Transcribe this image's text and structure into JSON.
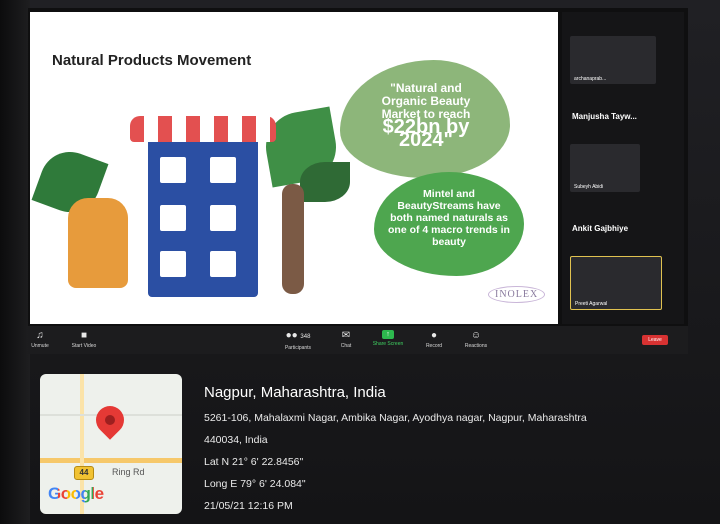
{
  "slide": {
    "title": "Natural Products Movement",
    "callout1_line1": "\"Natural and",
    "callout1_line2": "Organic Beauty",
    "callout1_line3": "Market to reach",
    "callout1_big": "$22bn by 2024\"",
    "callout2": "Mintel and BeautyStreams have both named naturals as one of 4 macro trends in beauty",
    "logo": "INOLEX"
  },
  "zoom_toolbar": {
    "unmute": "Unmute",
    "start_video": "Start Video",
    "participants": "Participants",
    "participants_count": "348",
    "chat": "Chat",
    "share_screen": "Share Screen",
    "record": "Record",
    "reactions": "Reactions",
    "leave": "Leave"
  },
  "participants_panel": {
    "tile1_caption": "archanaprab...",
    "name2": "Manjusha Tayw...",
    "tile2_caption": "Subeyh Abidi",
    "name3": "Ankit Gajbhiye",
    "tile3_caption": "Preeti Agarwal"
  },
  "geotag": {
    "place": "Nagpur, Maharashtra, India",
    "address_line1": "5261-106, Mahalaxmi Nagar, Ambika Nagar, Ayodhya nagar, Nagpur, Maharashtra",
    "address_line2": "440034, India",
    "lat": "Lat N 21° 6' 22.8456\"",
    "long": "Long E 79° 6' 24.084\"",
    "datetime": "21/05/21 12:16 PM",
    "map_route_number": "44",
    "map_road_label": "Ring Rd",
    "map_brand": "Google"
  }
}
